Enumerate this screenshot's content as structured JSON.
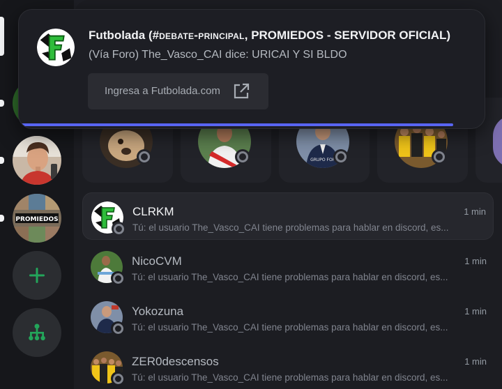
{
  "notification": {
    "title_prefix": "Futbolada (#",
    "title_channel": "debate-principal",
    "title_suffix": ", PROMIEDOS - SERVIDOR OFICIAL)",
    "body": "(Vía Foro) The_Vasco_CAI dice: URICAI Y SI BLDO",
    "button_label": "Ingresa a Futbolada.com",
    "button_icon": "external-link-icon",
    "accent_color": "#5865f2"
  },
  "rail": {
    "servers": [
      {
        "name": "server-avatar-person",
        "icon": "avatar-image"
      },
      {
        "name": "server-promiedos",
        "icon": "promiedos-logo",
        "logo_text": "PROMIEDOS"
      }
    ],
    "add_icon": "plus-icon",
    "discover_icon": "discover-hub-icon",
    "accent_green": "#23a55a"
  },
  "stories": [
    {
      "icon": "avatar-dog"
    },
    {
      "icon": "avatar-soccer-player"
    },
    {
      "icon": "avatar-suit",
      "caption": "GRUPO FOR"
    },
    {
      "icon": "avatar-team"
    }
  ],
  "dms": [
    {
      "name": "CLRKM",
      "time": "1 min",
      "preview": "Tú: el usuario The_Vasco_CAI tiene problemas para hablar en discord, es..."
    },
    {
      "name": "NicoCVM",
      "time": "1 min",
      "preview": "Tú: el usuario The_Vasco_CAI tiene problemas para hablar en discord, es..."
    },
    {
      "name": "Yokozuna",
      "time": "1 min",
      "preview": "Tú: el usuario The_Vasco_CAI tiene problemas para hablar en discord, es..."
    },
    {
      "name": "ZER0descensos",
      "time": "1 min",
      "preview": "Tú: el usuario The_Vasco_CAI tiene problemas para hablar en discord, es..."
    }
  ]
}
